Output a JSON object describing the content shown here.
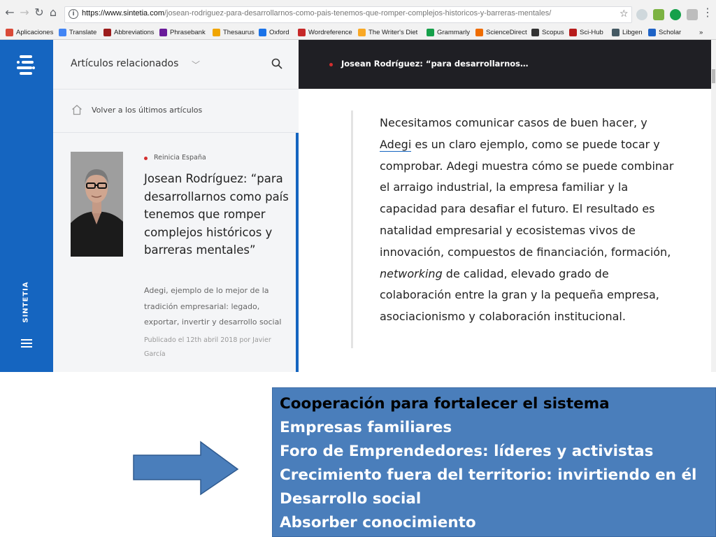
{
  "browser": {
    "url_host": "https://www.sintetia.com",
    "url_path": "/josean-rodriguez-para-desarrollarnos-como-pais-tenemos-que-romper-complejos-historicos-y-barreras-mentales/",
    "bookmarks": [
      {
        "label": "Aplicaciones",
        "color": "#d94a38"
      },
      {
        "label": "Translate",
        "color": "#4285f4"
      },
      {
        "label": "Abbreviations",
        "color": "#9c1c1c"
      },
      {
        "label": "Phrasebank",
        "color": "#6a1b9a"
      },
      {
        "label": "Thesaurus",
        "color": "#f0a500"
      },
      {
        "label": "Oxford",
        "color": "#1a73e8"
      },
      {
        "label": "Wordreference",
        "color": "#c62828"
      },
      {
        "label": "The Writer's Diet",
        "color": "#f9a825"
      },
      {
        "label": "Grammarly",
        "color": "#15a04a"
      },
      {
        "label": "ScienceDirect",
        "color": "#ef6c00"
      },
      {
        "label": "Scopus",
        "color": "#333333"
      },
      {
        "label": "Sci-Hub",
        "color": "#b71c1c"
      },
      {
        "label": "Libgen",
        "color": "#455a64"
      },
      {
        "label": "Scholar",
        "color": "#1e63c6"
      }
    ],
    "more_label": "»"
  },
  "site": {
    "brand": "SINTETIA",
    "panel_title": "Artículos relacionados",
    "back_link": "Volver a los últimos artículos",
    "topbar_title": "Josean Rodríguez: “para desarrollarnos…",
    "card": {
      "category": "Reinicia España",
      "title": "Josean Rodríguez: “para desarrollarnos como país tenemos que romper complejos históricos y barreras mentales”",
      "excerpt": "Adegi, ejemplo de lo mejor de la tradición empresarial: legado, exportar, invertir y desarrollo social",
      "meta": "Publicado el 12th abril 2018 por Javier García"
    },
    "quote": {
      "before_link": "Necesitamos comunicar casos de buen hacer, y ",
      "link": "Adegi",
      "middle": " es un claro ejemplo, como se puede tocar y comprobar. Adegi muestra cómo se puede combinar el arraigo industrial, la empresa familiar y la capacidad para desafiar el futuro. El resultado es natalidad empresarial y ecosistemas vivos de innovación, compuestos de financiación, formación, ",
      "italic": "networking",
      "after": " de calidad, elevado grado de colaboración entre la gran y la pequeña empresa, asociacionismo y colaboración institucional."
    }
  },
  "slide": {
    "lines": [
      "Cooperación para fortalecer el sistema",
      "Empresas familiares",
      "Foro de Emprendedores: líderes y activistas",
      "Crecimiento fuera del territorio: invirtiendo en él",
      "Desarrollo social",
      "Absorber conocimiento"
    ]
  }
}
